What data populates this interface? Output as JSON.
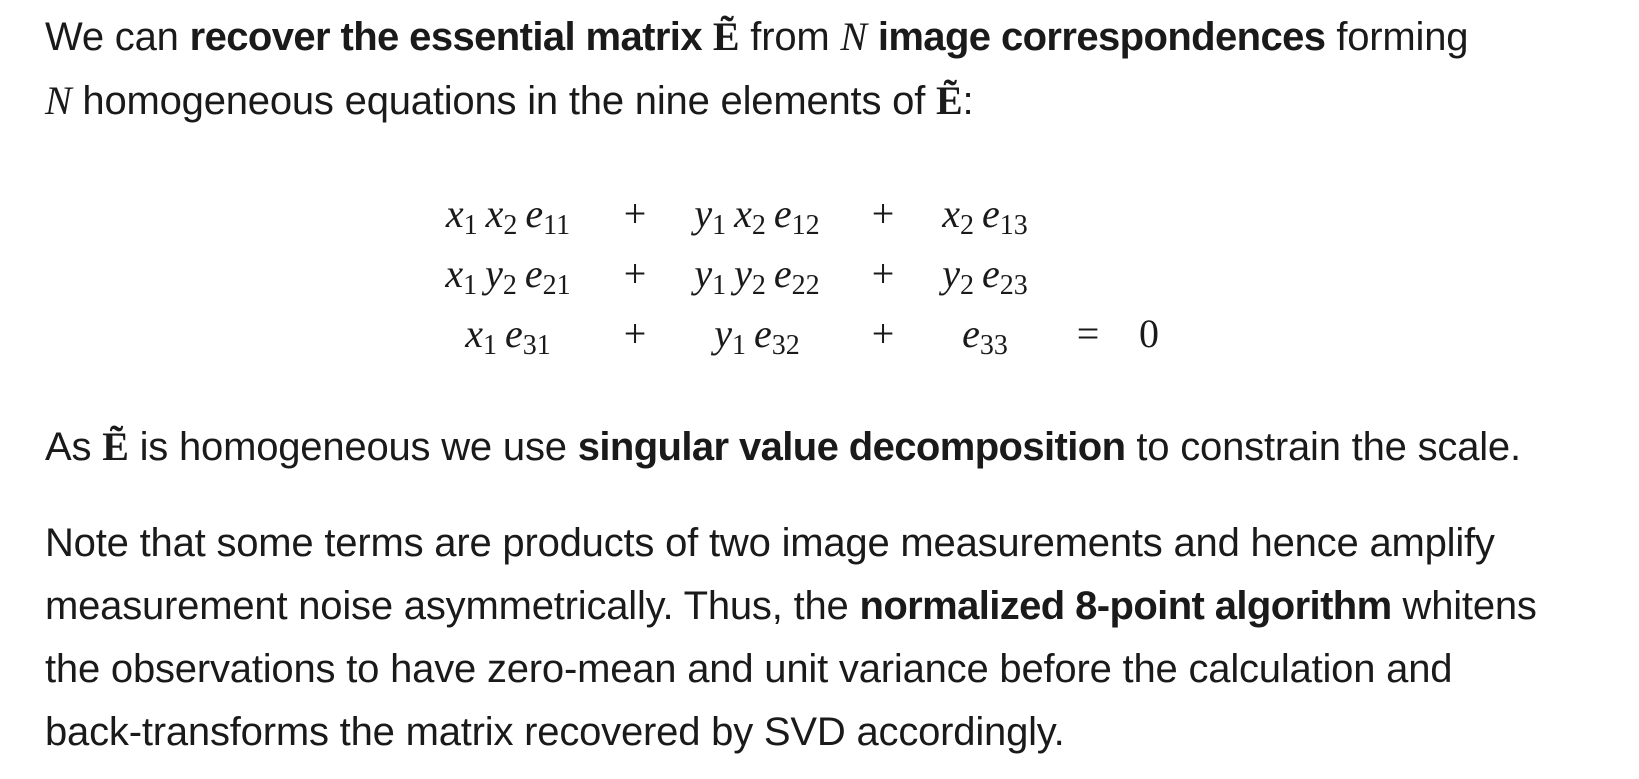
{
  "paragraph1": {
    "line1": {
      "t1": "We can ",
      "b1": "recover the essential matrix",
      "t2": " ",
      "m1": "Ẽ",
      "t3": " from ",
      "m2": "N",
      "t4": " ",
      "b2": "image correspondences",
      "t5": " forming"
    },
    "line2": {
      "m1": "N",
      "t1": " homogeneous equations in the nine elements of ",
      "m2": "Ẽ",
      "t2": ":"
    }
  },
  "equations": {
    "rows": [
      {
        "c1": [
          {
            "v": "x",
            "s": "1"
          },
          {
            "v": "x",
            "s": "2"
          },
          {
            "v": "e",
            "s": "11"
          }
        ],
        "op1": "+",
        "c2": [
          {
            "v": "y",
            "s": "1"
          },
          {
            "v": "x",
            "s": "2"
          },
          {
            "v": "e",
            "s": "12"
          }
        ],
        "op2": "+",
        "c3": [
          {
            "v": "x",
            "s": "2"
          },
          {
            "v": "e",
            "s": "13"
          }
        ],
        "eq": "",
        "rhs": ""
      },
      {
        "c1": [
          {
            "v": "x",
            "s": "1"
          },
          {
            "v": "y",
            "s": "2"
          },
          {
            "v": "e",
            "s": "21"
          }
        ],
        "op1": "+",
        "c2": [
          {
            "v": "y",
            "s": "1"
          },
          {
            "v": "y",
            "s": "2"
          },
          {
            "v": "e",
            "s": "22"
          }
        ],
        "op2": "+",
        "c3": [
          {
            "v": "y",
            "s": "2"
          },
          {
            "v": "e",
            "s": "23"
          }
        ],
        "eq": "",
        "rhs": ""
      },
      {
        "c1": [
          {
            "v": "x",
            "s": "1"
          },
          {
            "v": "e",
            "s": "31"
          }
        ],
        "op1": "+",
        "c2": [
          {
            "v": "y",
            "s": "1"
          },
          {
            "v": "e",
            "s": "32"
          }
        ],
        "op2": "+",
        "c3": [
          {
            "v": "e",
            "s": "33"
          }
        ],
        "eq": "=",
        "rhs": "0"
      }
    ]
  },
  "paragraph2": {
    "t1": "As ",
    "m1": "Ẽ",
    "t2": " is homogeneous we use ",
    "b1": "singular value decomposition",
    "t3": " to constrain the scale."
  },
  "paragraph3": {
    "line1": "Note that some terms are products of two image measurements and hence amplify",
    "line2": {
      "t1": "measurement noise asymmetrically. Thus, the ",
      "b1": "normalized 8-point algorithm",
      "t2": " whitens"
    },
    "line3": "the observations to have zero-mean and unit variance before the calculation and",
    "line4": "back-transforms the matrix recovered by SVD accordingly."
  }
}
